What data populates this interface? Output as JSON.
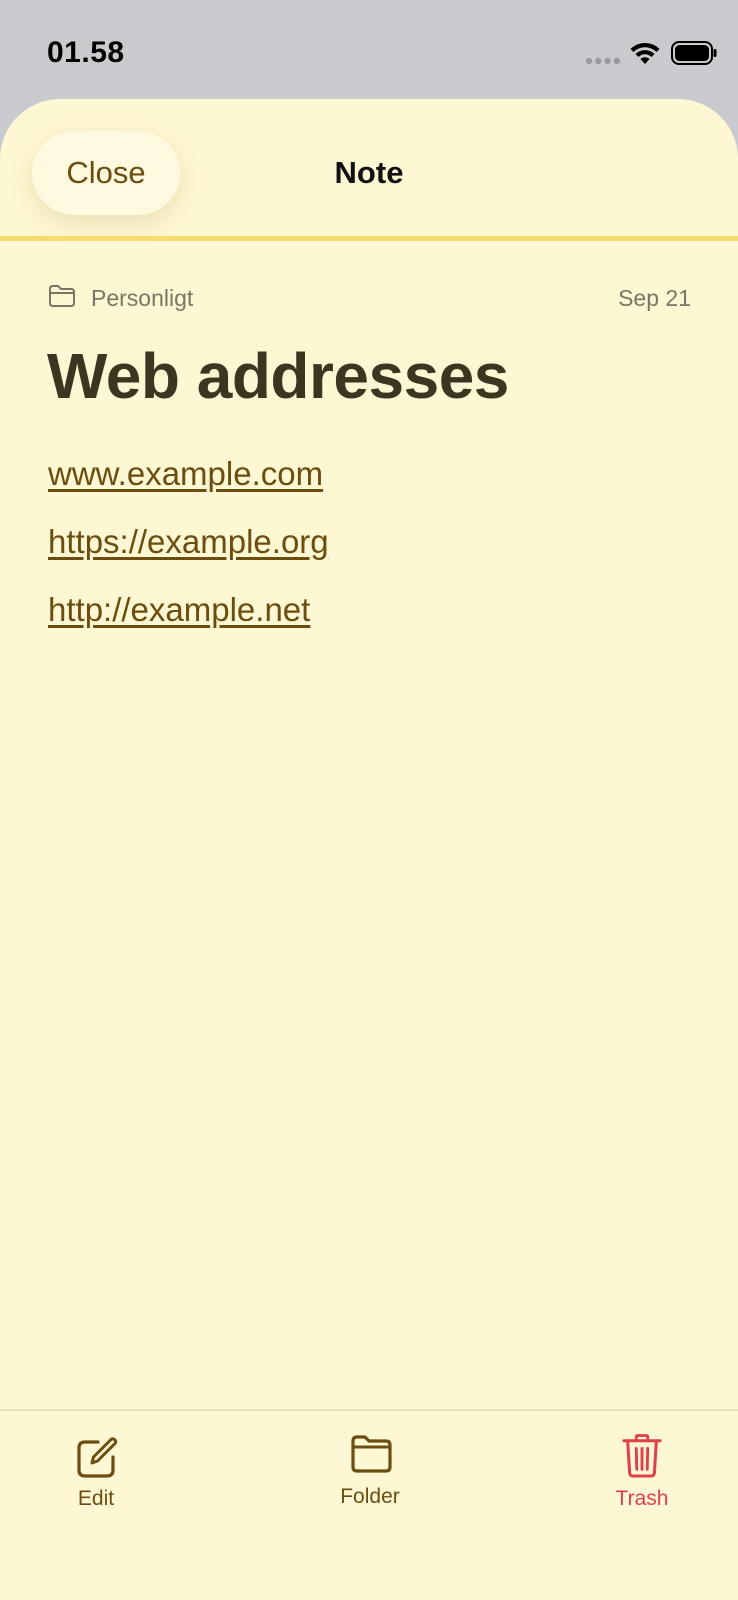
{
  "status_bar": {
    "time": "01.58"
  },
  "nav": {
    "close_label": "Close",
    "title": "Note"
  },
  "note": {
    "folder": "Personligt",
    "date": "Sep 21",
    "title": "Web addresses",
    "links": [
      "www.example.com",
      "https://example.org",
      "http://example.net"
    ]
  },
  "toolbar": {
    "edit_label": "Edit",
    "folder_label": "Folder",
    "trash_label": "Trash"
  },
  "icons": {
    "close": "none",
    "folder_meta": "folder-icon",
    "edit": "square-pencil-icon",
    "folder": "folder-icon",
    "trash": "trash-icon"
  },
  "colors": {
    "sheet_background": "#fef7d4",
    "accent": "#6b4e0f",
    "divider": "#f6dc6c",
    "destructive": "#e0404a"
  }
}
